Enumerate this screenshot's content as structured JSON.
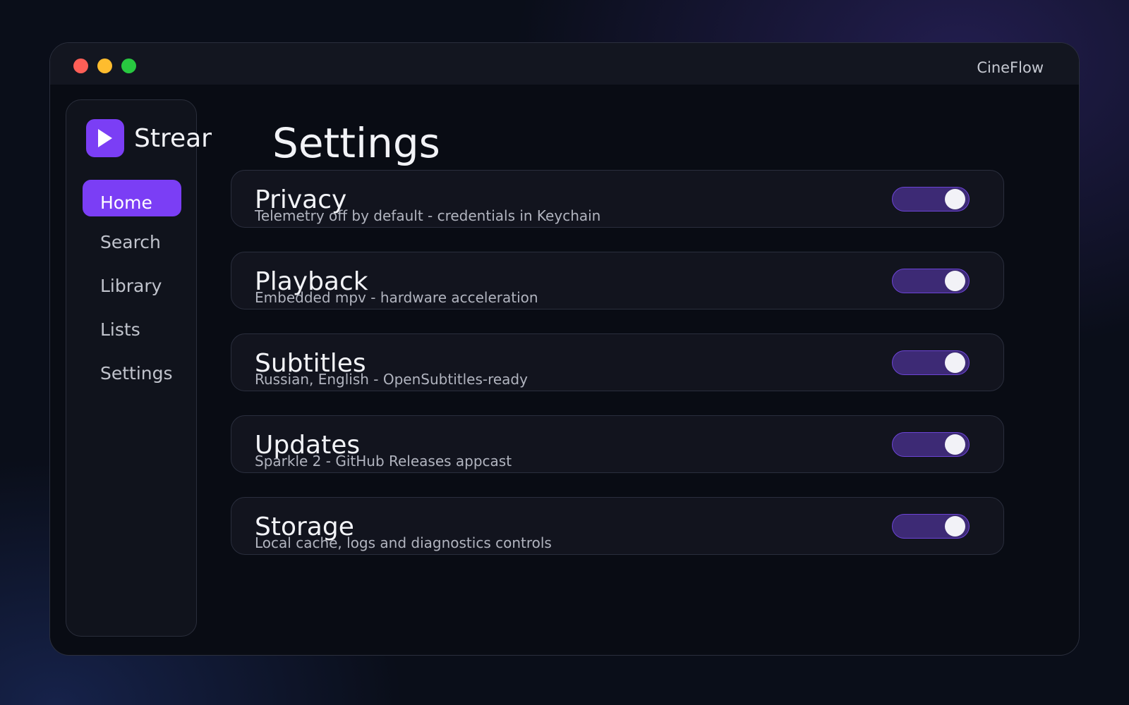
{
  "window": {
    "title": "CineFlow"
  },
  "sidebar": {
    "brand_name": "Stream",
    "items": [
      {
        "label": "Home",
        "active": true
      },
      {
        "label": "Search",
        "active": false
      },
      {
        "label": "Library",
        "active": false
      },
      {
        "label": "Lists",
        "active": false
      },
      {
        "label": "Settings",
        "active": false
      }
    ]
  },
  "main": {
    "title": "Settings",
    "settings": [
      {
        "title": "Privacy",
        "description": "Telemetry off by default - credentials in Keychain",
        "enabled": true
      },
      {
        "title": "Playback",
        "description": "Embedded mpv - hardware acceleration",
        "enabled": true
      },
      {
        "title": "Subtitles",
        "description": "Russian, English - OpenSubtitles-ready",
        "enabled": true
      },
      {
        "title": "Updates",
        "description": "Sparkle 2 - GitHub Releases appcast",
        "enabled": true
      },
      {
        "title": "Storage",
        "description": "Local cache, logs and diagnostics controls",
        "enabled": true
      }
    ]
  },
  "colors": {
    "accent": "#7b3ef5",
    "toggle_track": "#3d2a75",
    "traffic_red": "#fe5f57",
    "traffic_yellow": "#febc2e",
    "traffic_green": "#28c840"
  },
  "icons": {
    "brand": "play-icon"
  }
}
